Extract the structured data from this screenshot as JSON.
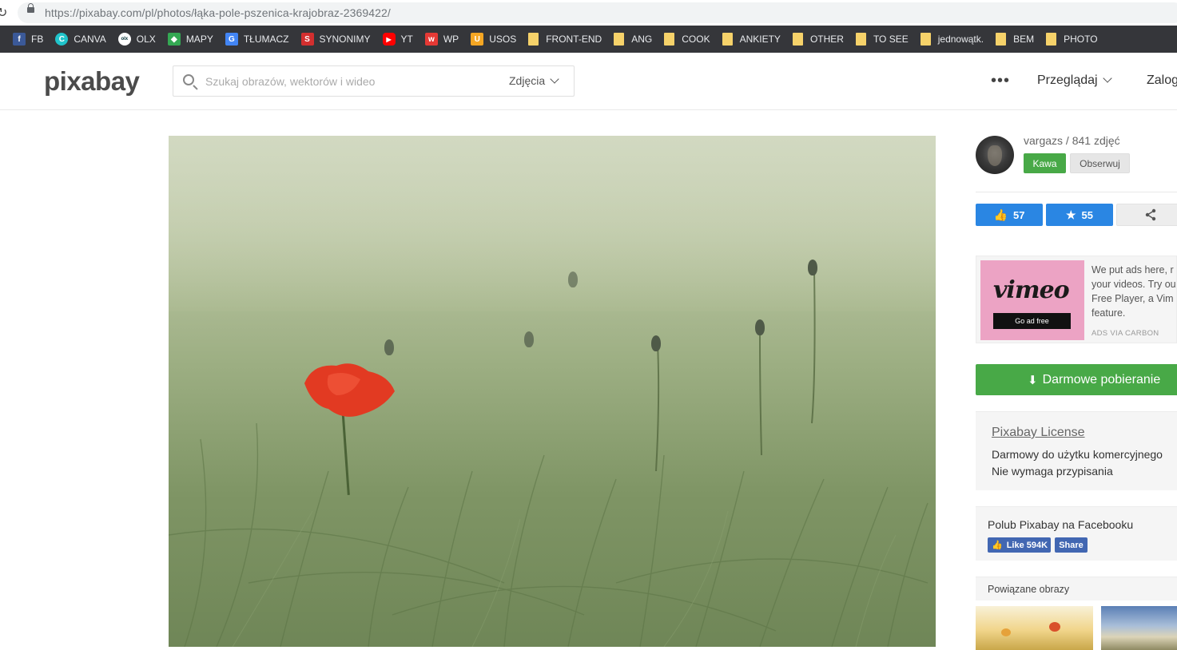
{
  "browser": {
    "url_host": "https://pixabay.com",
    "url_path": "/pl/photos/łąka-pole-pszenica-krajobraz-2369422/"
  },
  "bookmarks": [
    {
      "label": "FB",
      "icon": "facebook-icon",
      "color": "#3b5998",
      "glyph": "f"
    },
    {
      "label": "CANVA",
      "icon": "canva-icon",
      "color": "#20c4cb",
      "glyph": "C"
    },
    {
      "label": "OLX",
      "icon": "olx-icon",
      "color": "#ffffff",
      "glyph": "olx"
    },
    {
      "label": "MAPY",
      "icon": "maps-icon",
      "color": "#34a853",
      "glyph": "◆"
    },
    {
      "label": "TŁUMACZ",
      "icon": "translate-icon",
      "color": "#4285f4",
      "glyph": "G"
    },
    {
      "label": "SYNONIMY",
      "icon": "synonimy-icon",
      "color": "#d32f2f",
      "glyph": "S"
    },
    {
      "label": "YT",
      "icon": "youtube-icon",
      "color": "#ff0000",
      "glyph": "▶"
    },
    {
      "label": "WP",
      "icon": "wp-icon",
      "color": "#e53935",
      "glyph": "w"
    },
    {
      "label": "USOS",
      "icon": "usos-icon",
      "color": "#f5a623",
      "glyph": "U"
    },
    {
      "label": "FRONT-END",
      "icon": "folder-icon"
    },
    {
      "label": "ANG",
      "icon": "folder-icon"
    },
    {
      "label": "COOK",
      "icon": "folder-icon"
    },
    {
      "label": "ANKIETY",
      "icon": "folder-icon"
    },
    {
      "label": "OTHER",
      "icon": "folder-icon"
    },
    {
      "label": "TO SEE",
      "icon": "folder-icon"
    },
    {
      "label": "jednowątk.",
      "icon": "folder-icon"
    },
    {
      "label": "BEM",
      "icon": "folder-icon"
    },
    {
      "label": "PHOTO",
      "icon": "folder-icon"
    }
  ],
  "header": {
    "logo": "pixabay",
    "search_placeholder": "Szukaj obrazów, wektorów i wideo",
    "search_type": "Zdjęcia",
    "more": "•••",
    "browse": "Przeglądaj",
    "login": "Zalog"
  },
  "author": {
    "name": "vargazs",
    "photo_count": " / 841 zdjęć",
    "coffee_label": "Kawa",
    "follow_label": "Obserwuj"
  },
  "stats": {
    "likes": "57",
    "favorites": "55"
  },
  "ad": {
    "logo": "vimeo",
    "cta": "Go ad free",
    "text": "We put ads here, r your videos. Try ou Free Player, a Vim feature.",
    "via": "ADS VIA CARBON",
    "bg": "#eca3c4"
  },
  "download": {
    "label": "Darmowe pobieranie",
    "color": "#48a947"
  },
  "license": {
    "title": "Pixabay License",
    "line1": "Darmowy do użytku komercyjnego",
    "line2": "Nie wymaga przypisania"
  },
  "facebook": {
    "title": "Polub Pixabay na Facebooku",
    "like": "Like 594K",
    "share": "Share"
  },
  "related": {
    "title": "Powiązane obrazy"
  }
}
